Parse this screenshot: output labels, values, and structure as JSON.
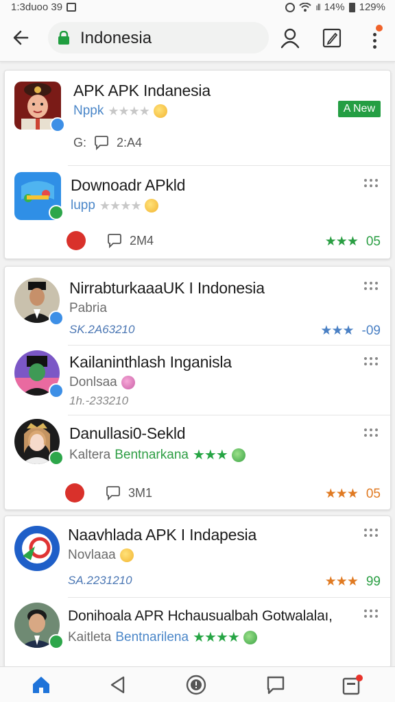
{
  "status_bar": {
    "time": "1:3duoo 39",
    "battery_text": "14%",
    "battery_text2": "129%"
  },
  "toolbar": {
    "url": "Indonesia"
  },
  "colors": {
    "accent_green": "#2da64a",
    "accent_blue": "#3d8fe6",
    "star_orange": "#e07a22",
    "notif": "#f0622a"
  },
  "cards": [
    {
      "items": [
        {
          "title": "APK APK Indanesia",
          "sub": "Nppk",
          "stars": "★★★★",
          "meta_left": "G:",
          "comments": "2:A4",
          "new_label": "A New"
        },
        {
          "title": "Downoadr APkld",
          "sub": "lupp",
          "stars": "★★★★",
          "comments": "2M4",
          "rating_stars": "★★★",
          "rating_value": "05"
        }
      ]
    },
    {
      "items": [
        {
          "title": "NirrabturkaaaUK I Indonesia",
          "sub": "Pabria",
          "meta": "SK.2A63210",
          "rating_stars": "★★★",
          "rating_value": "-09"
        },
        {
          "title": "Kailaninthlash Inganisla",
          "sub": "Donlsaa",
          "meta": "1h.-233210"
        },
        {
          "title": "Danullasi0-Sekld",
          "sub": "Kaltera",
          "sub_green": "Bentnarkana",
          "stars": "★★★",
          "comments": "3M1",
          "rating_stars": "★★★",
          "rating_value": "05"
        }
      ]
    },
    {
      "items": [
        {
          "title": "Naavhlada APK I Indapesia",
          "sub": "Novlaaa",
          "meta": "SA.2231210",
          "rating_stars": "★★★",
          "rating_value": "99"
        },
        {
          "title": "Donihoala APR Hchausualbah Gotwalalaı,",
          "sub": "Kaitleta",
          "sub_blue": "Bentnarilena",
          "stars": "★★★★"
        }
      ]
    }
  ],
  "bottom_nav": [
    "home-icon",
    "back-triangle-icon",
    "info-icon",
    "chat-icon",
    "notifications-icon"
  ]
}
